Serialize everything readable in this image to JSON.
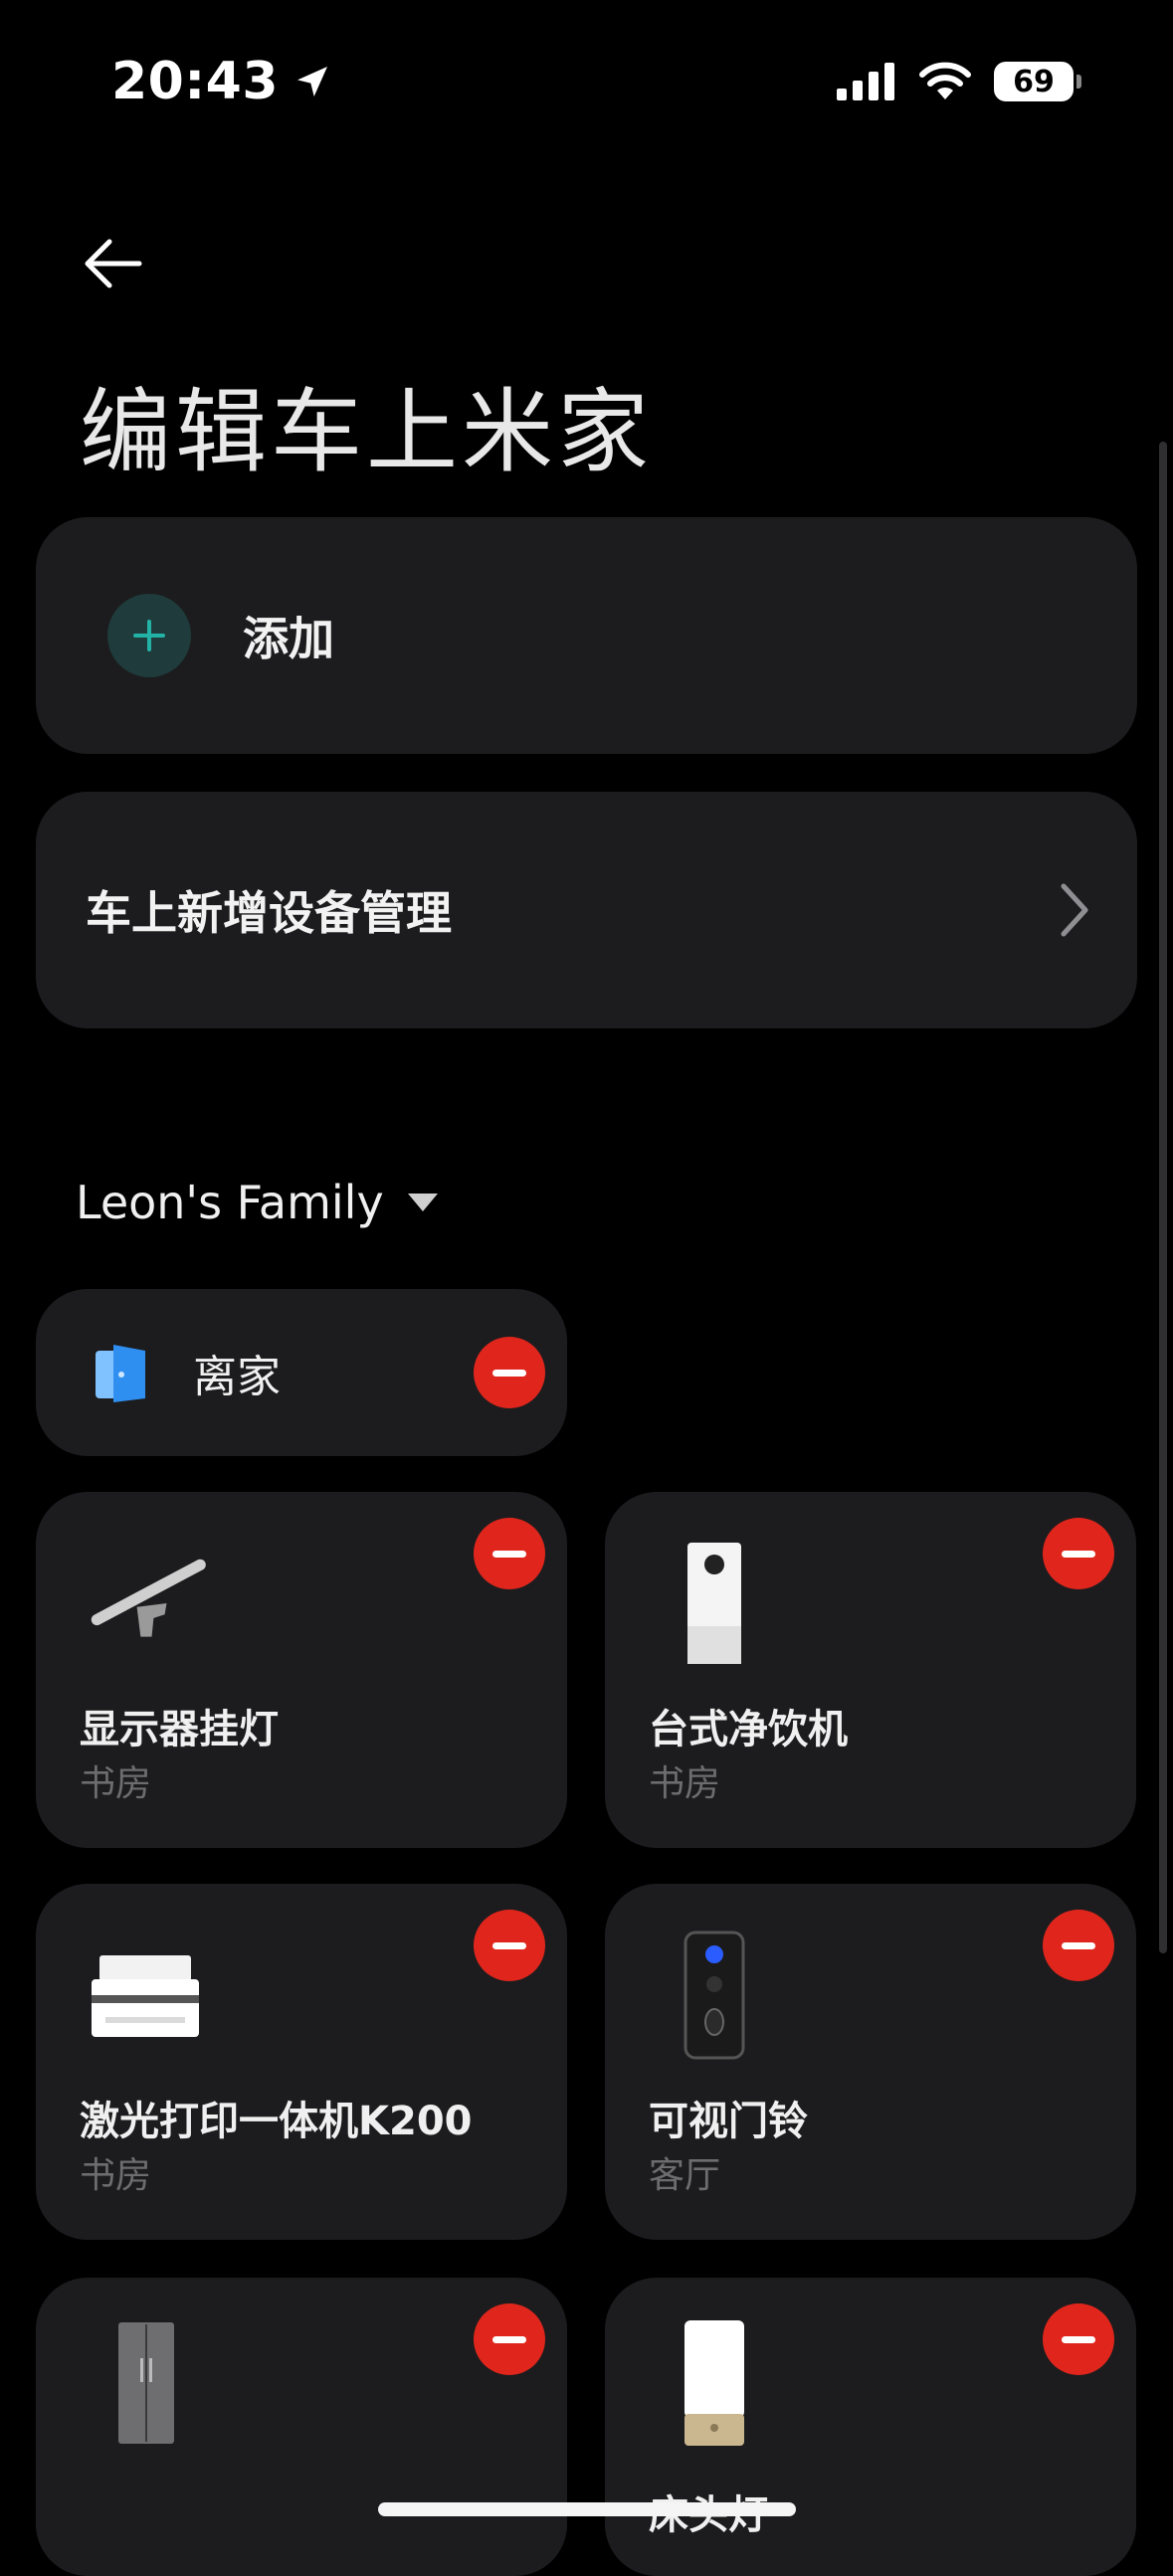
{
  "status": {
    "time": "20:43",
    "battery": "69"
  },
  "page": {
    "title": "编辑车上米家"
  },
  "add_card": {
    "label": "添加"
  },
  "manage_card": {
    "label": "车上新增设备管理"
  },
  "family": {
    "name": "Leon's Family"
  },
  "scene": {
    "label": "离家"
  },
  "devices": [
    {
      "name": "显示器挂灯",
      "room": "书房",
      "icon": "monitor-light-icon"
    },
    {
      "name": "台式净饮机",
      "room": "书房",
      "icon": "water-purifier-icon"
    },
    {
      "name": "激光打印一体机K200",
      "room": "书房",
      "icon": "printer-icon"
    },
    {
      "name": "可视门铃",
      "room": "客厅",
      "icon": "doorbell-icon"
    },
    {
      "name": "",
      "room": "",
      "icon": "refrigerator-icon"
    },
    {
      "name": "床头灯",
      "room": "",
      "icon": "bedside-lamp-icon"
    }
  ],
  "colors": {
    "accent": "#23b3a6",
    "remove": "#e0261c",
    "card": "#1c1c1e",
    "background": "#000000"
  }
}
